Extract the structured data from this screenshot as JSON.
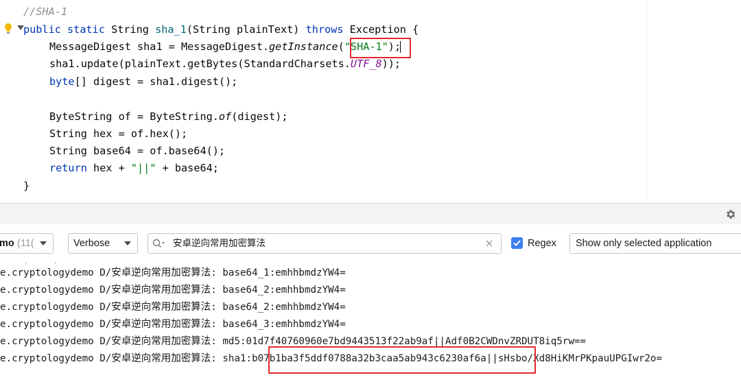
{
  "editor": {
    "comment": "//SHA-1",
    "sig_kw1": "public",
    "sig_kw2": "static",
    "sig_type": "String",
    "sig_name": "sha_1",
    "sig_params": "(String plainText)",
    "sig_kw3": "throws",
    "sig_end": "Exception {",
    "l1_a": "MessageDigest sha1 = MessageDigest.",
    "l1_b": "getInstance",
    "l1_c": "(",
    "l1_str": "\"SHA-1\"",
    "l1_d": ");",
    "l2_a": "sha1.update(plainText.getBytes(StandardCharsets.",
    "l2_const": "UTF_8",
    "l2_b": "));",
    "l3_kw": "byte",
    "l3_a": "[] digest = sha1.digest();",
    "l4_a": "ByteString of = ByteString.",
    "l4_b": "of",
    "l4_c": "(digest);",
    "l5": "String hex = of.hex();",
    "l6": "String base64 = of.base64();",
    "l7_kw": "return",
    "l7_a": " hex + ",
    "l7_str": "\"||\"",
    "l7_b": " + base64;",
    "l8": "}"
  },
  "filter": {
    "device_label": "mo",
    "device_count": "(11(",
    "level": "Verbose",
    "search_value": "安卓逆向常用加密算法",
    "regex_label": "Regex",
    "regex_checked": true,
    "app_filter": "Show only selected application"
  },
  "log": {
    "lines": [
      {
        "pkg": "e.cryptologydemo D/",
        "tag": "安卓逆向常用加密算法",
        "msg": ": base64_1:emhhbmdzYW4="
      },
      {
        "pkg": "e.cryptologydemo D/",
        "tag": "安卓逆向常用加密算法",
        "msg": ": base64_2:emhhbmdzYW4="
      },
      {
        "pkg": "e.cryptologydemo D/",
        "tag": "安卓逆向常用加密算法",
        "msg": ": base64_2:emhhbmdzYW4="
      },
      {
        "pkg": "e.cryptologydemo D/",
        "tag": "安卓逆向常用加密算法",
        "msg": ": base64_3:emhhbmdzYW4="
      },
      {
        "pkg": "e.cryptologydemo D/",
        "tag": "安卓逆向常用加密算法",
        "msg": ": md5:01d7f40760960e7bd9443513f22ab9af||Adf0B2CWDnvZRDUT8iq5rw=="
      }
    ],
    "last": {
      "pkg": "e.cryptologydemo D/",
      "tag": "安卓逆向常用加密算法",
      "prefix": ": sha1:",
      "hash": "b07b1ba3f5ddf0788a32b3caa5ab943c6230af6a",
      "suffix": "||sHsbo/Xd8HiKMrPKpauUPGIwr2o="
    }
  },
  "colors": {
    "keyword": "#0033b3",
    "string": "#067d17",
    "comment": "#8c8c8c",
    "method": "#00627a",
    "constant": "#871094",
    "highlight_box": "#e3272d",
    "checkbox": "#3c7ff1"
  },
  "icons": [
    "lightbulb-icon",
    "fold-arrow-icon",
    "gear-icon",
    "search-icon",
    "chevron-down-icon",
    "clear-icon",
    "check-icon"
  ]
}
